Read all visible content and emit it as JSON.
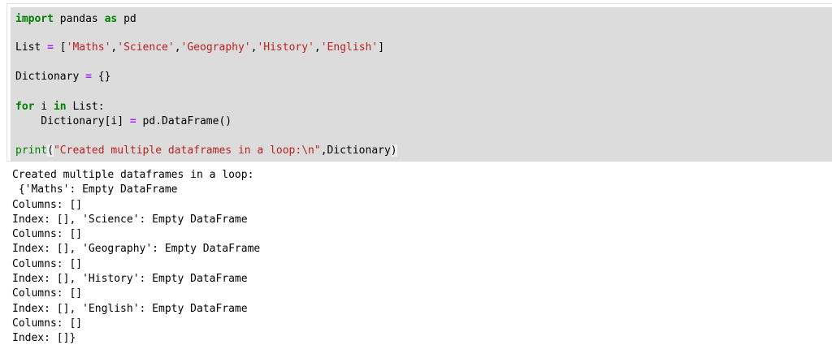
{
  "input_lines": [
    [
      {
        "t": "import",
        "c": "kw"
      },
      {
        "t": " pandas ",
        "c": ""
      },
      {
        "t": "as",
        "c": "kw"
      },
      {
        "t": " pd",
        "c": ""
      }
    ],
    [
      {
        "t": "List ",
        "c": ""
      },
      {
        "t": "=",
        "c": "op"
      },
      {
        "t": " [",
        "c": ""
      },
      {
        "t": "'Maths'",
        "c": "str"
      },
      {
        "t": ",",
        "c": ""
      },
      {
        "t": "'Science'",
        "c": "str"
      },
      {
        "t": ",",
        "c": ""
      },
      {
        "t": "'Geography'",
        "c": "str"
      },
      {
        "t": ",",
        "c": ""
      },
      {
        "t": "'History'",
        "c": "str"
      },
      {
        "t": ",",
        "c": ""
      },
      {
        "t": "'English'",
        "c": "str"
      },
      {
        "t": "]",
        "c": ""
      }
    ],
    [
      {
        "t": "Dictionary ",
        "c": ""
      },
      {
        "t": "=",
        "c": "op"
      },
      {
        "t": " {}",
        "c": ""
      }
    ],
    [
      {
        "t": "for",
        "c": "kw"
      },
      {
        "t": " i ",
        "c": ""
      },
      {
        "t": "in",
        "c": "kw"
      },
      {
        "t": " List:",
        "c": ""
      }
    ],
    [
      {
        "t": "    Dictionary[i] ",
        "c": ""
      },
      {
        "t": "=",
        "c": "op"
      },
      {
        "t": " pd.DataFrame()",
        "c": ""
      }
    ],
    [
      {
        "t": "print",
        "c": "fn"
      },
      {
        "t": "(",
        "c": "hl"
      },
      {
        "t": "\"Created multiple dataframes in a loop:\\n\"",
        "c": "str"
      },
      {
        "t": ",Dictionary",
        "c": ""
      },
      {
        "t": ")",
        "c": "hl"
      }
    ]
  ],
  "output_lines": [
    "Created multiple dataframes in a loop:",
    " {'Maths': Empty DataFrame",
    "Columns: []",
    "Index: [], 'Science': Empty DataFrame",
    "Columns: []",
    "Index: [], 'Geography': Empty DataFrame",
    "Columns: []",
    "Index: [], 'History': Empty DataFrame",
    "Columns: []",
    "Index: [], 'English': Empty DataFrame",
    "Columns: []",
    "Index: []}"
  ]
}
